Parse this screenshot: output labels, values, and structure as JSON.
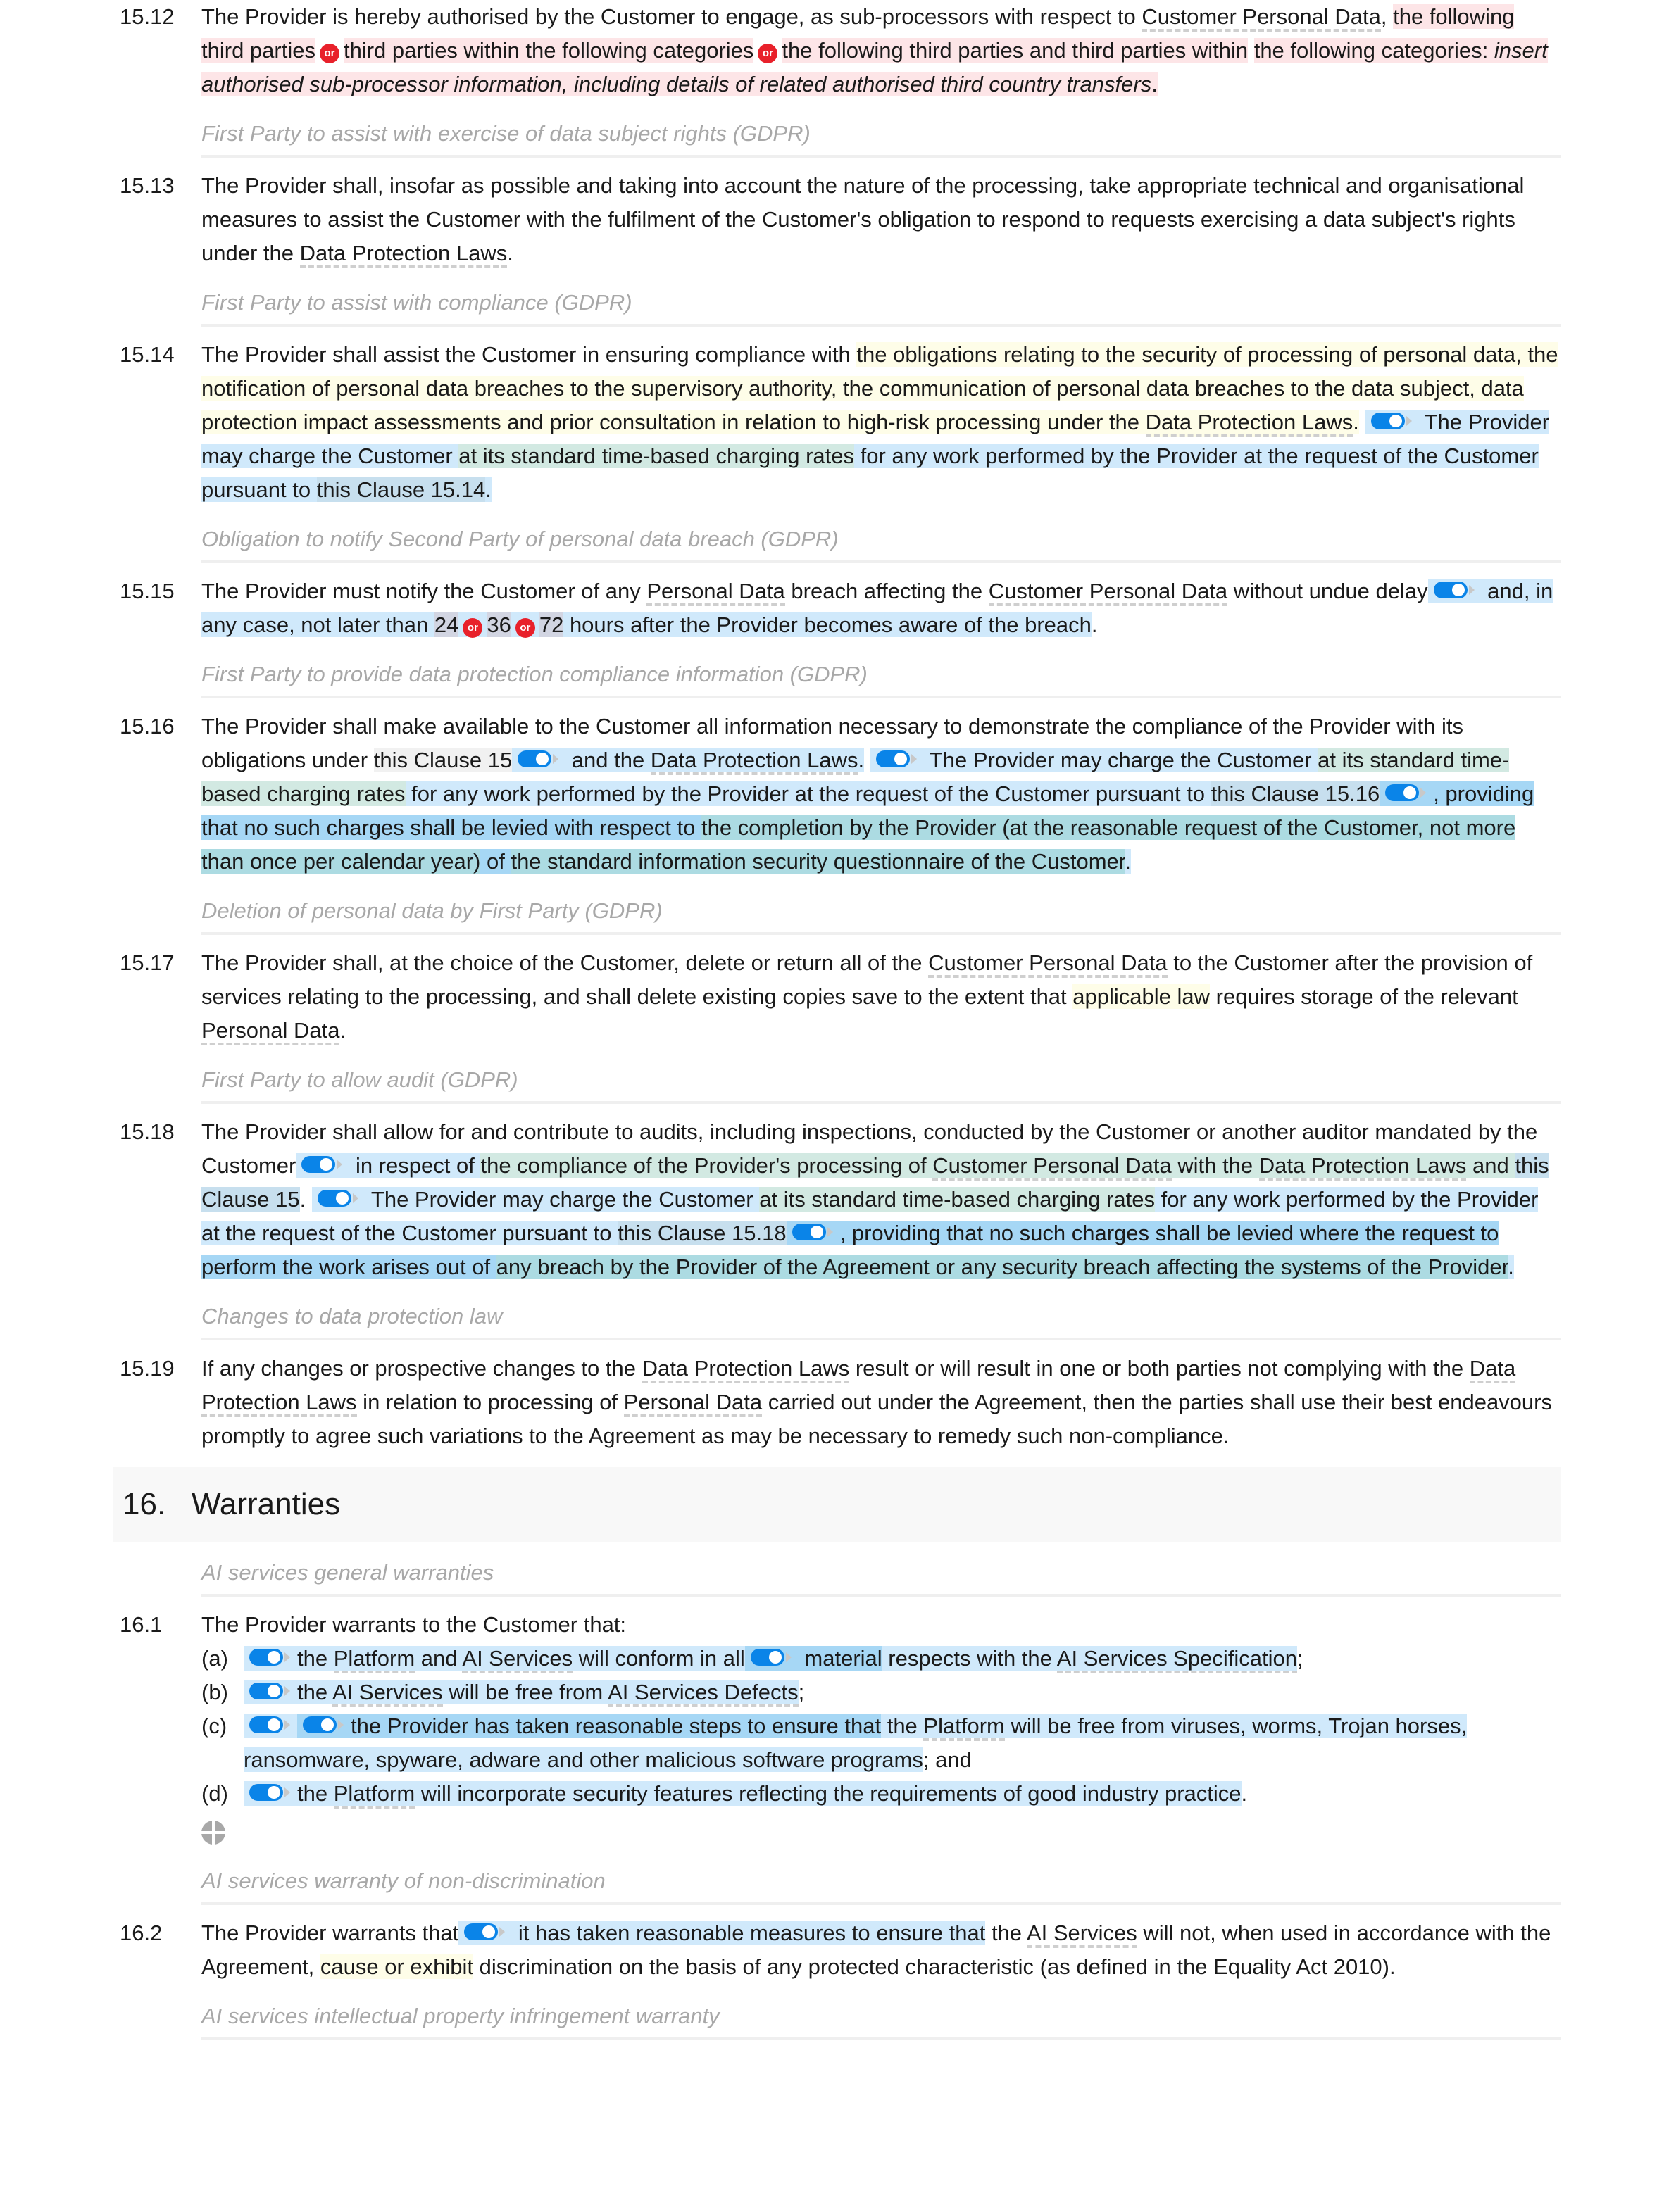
{
  "clauses": {
    "c1512": {
      "num": "15.12",
      "t1": "The Provider is hereby authorised by the Customer to engage, as sub-processors with respect to ",
      "term1": "Customer Personal Data",
      "t2": ",",
      "opt1": "the following third parties",
      "opt2": "third parties within the following categories",
      "opt3a": "the following third parties and third parties within",
      "opt3b": "the following categories",
      "colon": ": ",
      "insert": "insert authorised sub-processor information, including details of related authorised third country transfers",
      "end": "."
    },
    "h1513": "First Party to assist with exercise of data subject rights (GDPR)",
    "c1513": {
      "num": "15.13",
      "t1": "The Provider shall, insofar as possible and taking into account the nature of the processing, take appropriate technical and organisational measures to assist the Customer with the fulfilment of the Customer's obligation to respond to requests exercising a data subject's rights under the ",
      "term1": "Data Protection Laws",
      "end": "."
    },
    "h1514": "First Party to assist with compliance (GDPR)",
    "c1514": {
      "num": "15.14",
      "t1": "The Provider shall assist the Customer in ensuring compliance with ",
      "y1": "the obligations relating to the security of processing of personal data, the notification of personal data breaches to the supervisory authority, the communication of personal data breaches to the data subject, data protection impact assessments and prior consultation in relation to high-risk processing under the ",
      "term1": "Data Protection Laws",
      "y2": ".",
      "b1": " The Provider may charge the Customer ",
      "g1": "at its standard time-based charging rates",
      "b2": " for any work performed by the Provider at the request of the Customer pursuant to ",
      "s1": "this Clause 15.14",
      "b3": "."
    },
    "h1515": "Obligation to notify Second Party of personal data breach (GDPR)",
    "c1515": {
      "num": "15.15",
      "t1": "The Provider must notify the Customer of any ",
      "term1": "Personal Data",
      "t2": " breach affecting the ",
      "term2": "Customer Personal Data",
      "t3": " without undue delay",
      "b1": " and, in any case, not later than ",
      "n1": "24",
      "n2": "36",
      "n3": "72",
      "b2": " hours after the Provider becomes aware of the breach",
      "b3": "."
    },
    "h1516": "First Party to provide data protection compliance information (GDPR)",
    "c1516": {
      "num": "15.16",
      "t1": "The Provider shall make available to the Customer all information necessary to demonstrate the compliance of the Provider with its obligations under ",
      "gr1": "this Clause 15",
      "b1": " and the ",
      "term1": "Data Protection Laws",
      "b2": ".",
      "b3": " The Provider may charge the Customer ",
      "g1": "at its standard time-based charging rates",
      "b4": " for any work performed by the Provider at the request of the Customer pursuant to ",
      "s1": "this Clause 15.16",
      "d1": ", providing that no such charges shall be levied with respect to ",
      "tl1": "the completion by the Provider (at the reasonable request of the Customer, not more than once per calendar year)",
      "d2": " of ",
      "tl2": "the standard information security questionnaire of the Customer",
      "b5": "."
    },
    "h1517": "Deletion of personal data by First Party (GDPR)",
    "c1517": {
      "num": "15.17",
      "t1": "The Provider shall, at the choice of the Customer, delete or return all of the ",
      "term1": "Customer Personal Data",
      "t2": " to the Customer after the provision of services relating to the processing, and shall delete existing copies save to the extent that ",
      "y1": "applicable law",
      "t3": " requires storage of the relevant ",
      "term2": "Personal Data",
      "end": "."
    },
    "h1518": "First Party to allow audit (GDPR)",
    "c1518": {
      "num": "15.18",
      "t1": "The Provider shall allow for and contribute to audits, including inspections, conducted by the Customer or another auditor mandated by the Customer",
      "b1": " in respect of ",
      "g1": "the compliance of the Provider's processing of ",
      "term1": "Customer Personal Data",
      "g2": " with the ",
      "term2": "Data Protection Laws",
      "g3": " and ",
      "s1": "this Clause 15",
      "b2": ".",
      "b3": " The Provider may charge the Customer ",
      "g4": "at its standard time-based charging rates",
      "b4": " for any work performed by the Provider at the request of the Customer pursuant to ",
      "s2": "this Clause 15.18",
      "d1": ", providing that no such charges shall be levied where the request to perform the work arises out of ",
      "tl1": "any breach by the Provider of the Agreement or any security breach affecting the systems of the Provider",
      "b5": "."
    },
    "h1519": "Changes to data protection law",
    "c1519": {
      "num": "15.19",
      "t1": "If any changes or prospective changes to the ",
      "term1": "Data Protection Laws",
      "t2": " result or will result in one or both parties not complying with the ",
      "term2": "Data Protection Laws",
      "t3": " in relation to processing of ",
      "term3": "Personal Data",
      "t4": " carried out under the Agreement, then the parties shall use their best endeavours promptly to agree such variations to the Agreement as may be necessary to remedy such non-compliance."
    }
  },
  "section16": {
    "num": "16.",
    "title": "Warranties",
    "h161": "AI services general warranties",
    "c161": {
      "num": "16.1",
      "intro": "The Provider warrants to the Customer that:",
      "a_lbl": "(a)",
      "a1": "the ",
      "a_term1": "Platform",
      "a2": " and ",
      "a_term2": "AI Services",
      "a3": " will conform in all",
      "a4": " material",
      "a5": " respects with the ",
      "a_term3": "AI Services Specification",
      "a6": ";",
      "b_lbl": "(b)",
      "b1": "the ",
      "b_term1": "AI Services",
      "b2": " will be free from ",
      "b_term2": "AI Services Defects",
      "b3": ";",
      "c_lbl": "(c)",
      "c1": "the Provider has taken reasonable steps to ensure that",
      "c2": " the ",
      "c_term1": "Platform",
      "c3": " will be free from viruses, worms, Trojan horses, ransomware, spyware, adware and other malicious software programs",
      "c4": "; and",
      "d_lbl": "(d)",
      "d1": "the ",
      "d_term1": "Platform",
      "d2": " will incorporate security features reflecting the requirements of good industry practice",
      "d3": "."
    },
    "h162": "AI services warranty of non-discrimination",
    "c162": {
      "num": "16.2",
      "t1": "The Provider warrants that",
      "b1": " it has taken reasonable measures to ensure that",
      "t2": " the ",
      "term1": "AI Services",
      "t3": " will not, when used in accordance with the Agreement, ",
      "y1": "cause or exhibit",
      "t4": " discrimination on the basis of any protected characteristic (as defined in the Equality Act 2010)."
    },
    "h163": "AI services intellectual property infringement warranty"
  },
  "or_label": "or"
}
